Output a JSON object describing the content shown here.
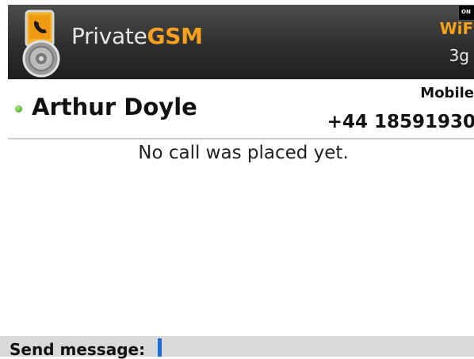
{
  "app": {
    "title_prefix": "Private",
    "title_suffix": "GSM",
    "logo_icon": "phone-padlock-icon"
  },
  "status": {
    "wifi_label": "WiFi",
    "network_label": "3g",
    "signal_badge": "ON"
  },
  "contact": {
    "name": "Arthur Doyle",
    "phone_type": "Mobile",
    "phone_number": "+44 18591930",
    "presence_icon": "online-dot-icon",
    "presence_color": "#4cb82a"
  },
  "history": {
    "empty_message": "No call was placed yet."
  },
  "composer": {
    "label": "Send message:",
    "value": "",
    "cursor_color": "#1f6bd8"
  },
  "colors": {
    "accent": "#f7a11f",
    "header_bg": "#2e2e2e"
  }
}
